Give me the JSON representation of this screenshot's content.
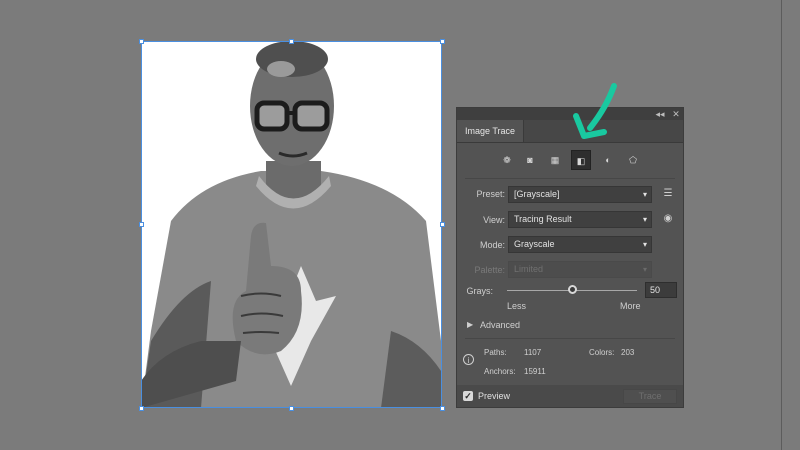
{
  "panel": {
    "tab_title": "Image Trace",
    "collapse_glyph": "◂◂",
    "close_glyph": "✕",
    "preset_icons": [
      {
        "name": "auto-color-icon",
        "glyph": "❁"
      },
      {
        "name": "high-color-icon",
        "glyph": "◙"
      },
      {
        "name": "low-color-icon",
        "glyph": "▦"
      },
      {
        "name": "grayscale-icon",
        "glyph": "◧"
      },
      {
        "name": "black-and-white-icon",
        "glyph": "◐"
      },
      {
        "name": "outline-icon",
        "glyph": "⬠"
      }
    ],
    "preset": {
      "label": "Preset:",
      "value": "[Grayscale]"
    },
    "view": {
      "label": "View:",
      "value": "Tracing Result"
    },
    "mode": {
      "label": "Mode:",
      "value": "Grayscale"
    },
    "palette": {
      "label": "Palette:",
      "value": "Limited"
    },
    "grays": {
      "label": "Grays:",
      "value": "50",
      "min_label": "Less",
      "max_label": "More",
      "level_percent": 50
    },
    "advanced_label": "Advanced",
    "stats": {
      "paths_label": "Paths:",
      "paths_value": "1107",
      "colors_label": "Colors:",
      "colors_value": "203",
      "anchors_label": "Anchors:",
      "anchors_value": "15911"
    },
    "preview_label": "Preview",
    "trace_button": "Trace"
  },
  "colors": {
    "canvas": "#7b7b7b",
    "panel": "#535353",
    "selection": "#4a8fe0",
    "annotation_arrow": "#19c9a0"
  }
}
